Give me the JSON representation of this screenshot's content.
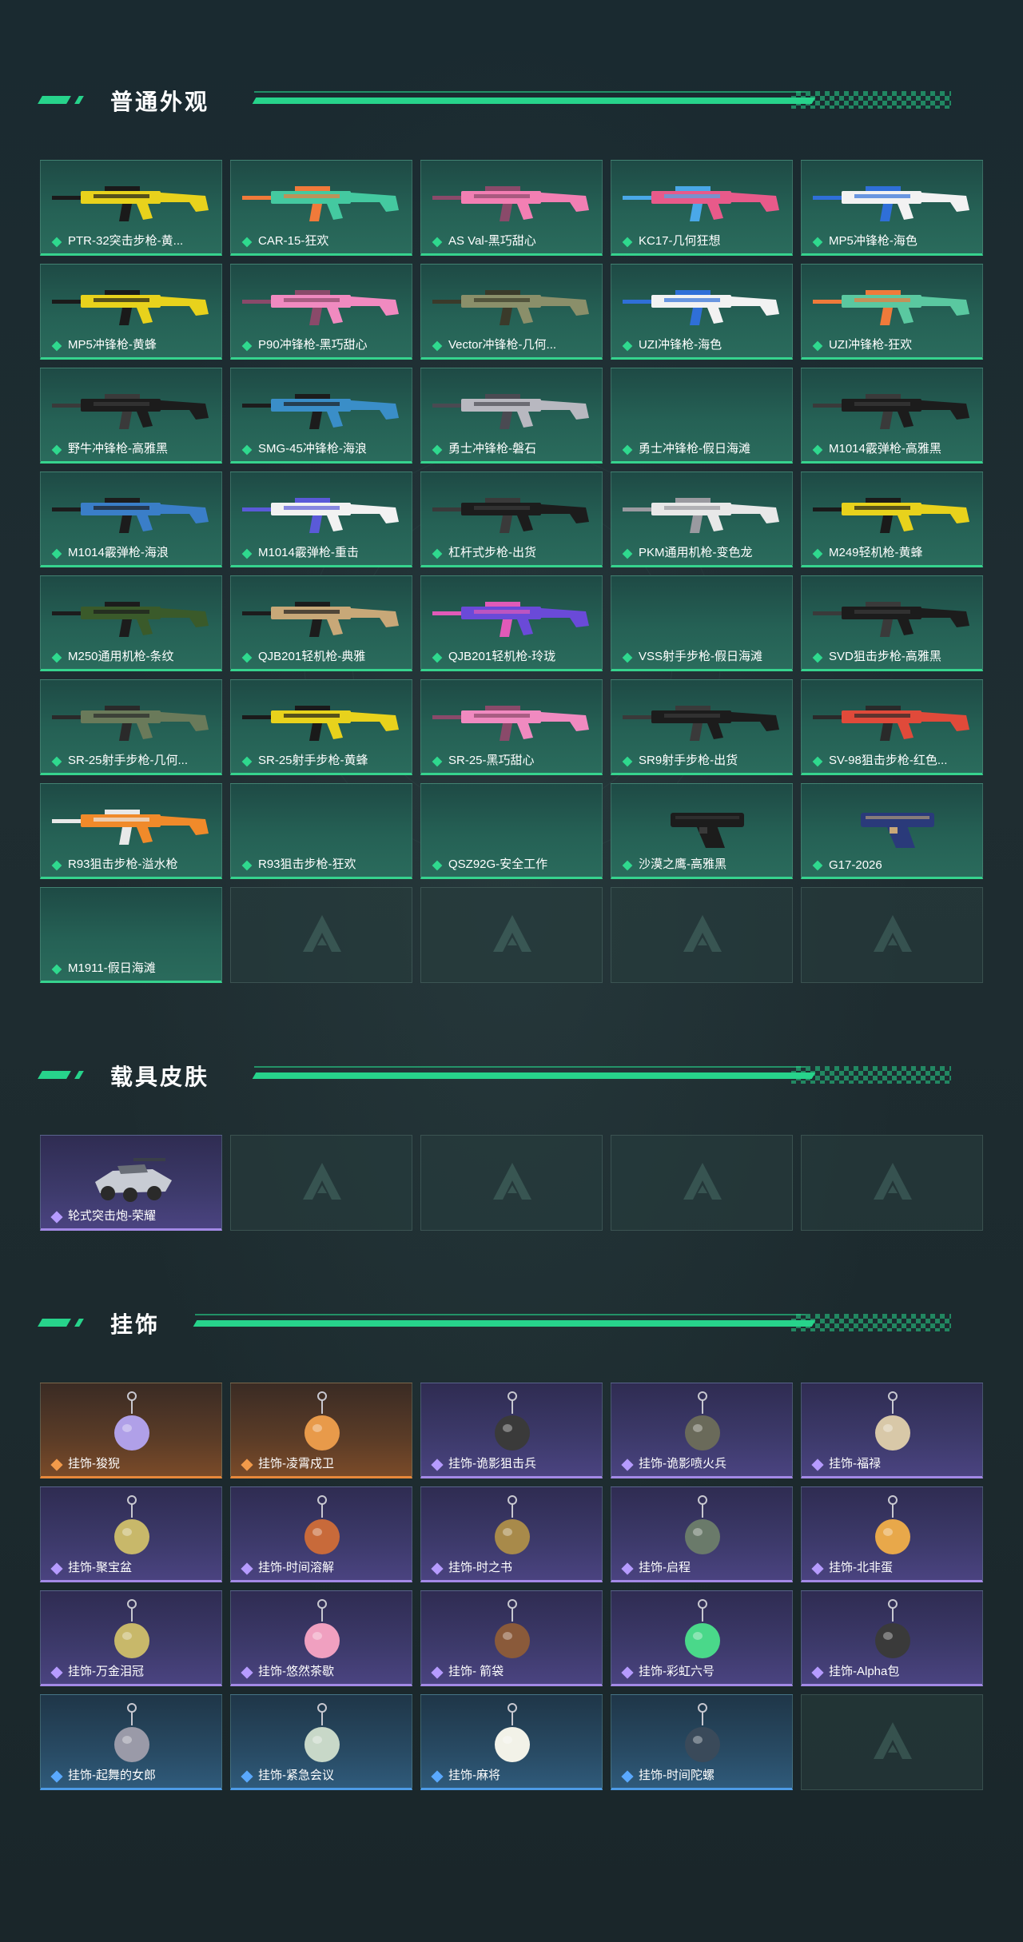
{
  "sections": {
    "weapons": {
      "title": "普通外观",
      "items": [
        {
          "label": "PTR-32突击步枪-黄...",
          "rarity": "green",
          "color": "#e8d21c",
          "accent": "#1a1a1a"
        },
        {
          "label": "CAR-15-狂欢",
          "rarity": "green",
          "color": "#44c9a0",
          "accent": "#f07a3a"
        },
        {
          "label": "AS Val-黑巧甜心",
          "rarity": "green",
          "color": "#f27fb3",
          "accent": "#8a4a6a"
        },
        {
          "label": "KC17-几何狂想",
          "rarity": "green",
          "color": "#e85a8a",
          "accent": "#4aa8e8"
        },
        {
          "label": "MP5冲锋枪-海色",
          "rarity": "green",
          "color": "#f2f2f2",
          "accent": "#2f6fd8"
        },
        {
          "label": "MP5冲锋枪-黄蜂",
          "rarity": "green",
          "color": "#e8d21c",
          "accent": "#1a1a1a"
        },
        {
          "label": "P90冲锋枪-黑巧甜心",
          "rarity": "green",
          "color": "#f08ac0",
          "accent": "#8a4a6a"
        },
        {
          "label": "Vector冲锋枪-几何...",
          "rarity": "green",
          "color": "#8a8f6a",
          "accent": "#3a3a2a"
        },
        {
          "label": "UZI冲锋枪-海色",
          "rarity": "green",
          "color": "#f2f2f2",
          "accent": "#2f6fd8"
        },
        {
          "label": "UZI冲锋枪-狂欢",
          "rarity": "green",
          "color": "#5ac8a0",
          "accent": "#f07a3a"
        },
        {
          "label": "野牛冲锋枪-高雅黑",
          "rarity": "green",
          "color": "#1c1c1c",
          "accent": "#3a3a3a"
        },
        {
          "label": "SMG-45冲锋枪-海浪",
          "rarity": "green",
          "color": "#3a8ec8",
          "accent": "#1c1c1c"
        },
        {
          "label": "勇士冲锋枪-磐石",
          "rarity": "green",
          "color": "#b8b8c0",
          "accent": "#4a4a52"
        },
        {
          "label": "勇士冲锋枪-假日海滩",
          "rarity": "green",
          "color": "",
          "accent": ""
        },
        {
          "label": "M1014霰弹枪-高雅黑",
          "rarity": "green",
          "color": "#1c1c1c",
          "accent": "#3a3a3a"
        },
        {
          "label": "M1014霰弹枪-海浪",
          "rarity": "green",
          "color": "#3a7ec8",
          "accent": "#1c1c1c"
        },
        {
          "label": "M1014霰弹枪-重击",
          "rarity": "green",
          "color": "#f2f2f2",
          "accent": "#5a5ad8"
        },
        {
          "label": "杠杆式步枪-出货",
          "rarity": "green",
          "color": "#1c1c1c",
          "accent": "#3a3a3a"
        },
        {
          "label": "PKM通用机枪-变色龙",
          "rarity": "green",
          "color": "#e8e8e8",
          "accent": "#9a9aa0"
        },
        {
          "label": "M249轻机枪-黄蜂",
          "rarity": "green",
          "color": "#e8d21c",
          "accent": "#1a1a1a"
        },
        {
          "label": "M250通用机枪-条纹",
          "rarity": "green",
          "color": "#3a5a2a",
          "accent": "#1c1c1c"
        },
        {
          "label": "QJB201轻机枪-典雅",
          "rarity": "green",
          "color": "#c8a878",
          "accent": "#1c1c1c"
        },
        {
          "label": "QJB201轻机枪-玲珑",
          "rarity": "green",
          "color": "#6a4ad8",
          "accent": "#e05ab8"
        },
        {
          "label": "VSS射手步枪-假日海滩",
          "rarity": "green",
          "color": "",
          "accent": ""
        },
        {
          "label": "SVD狙击步枪-高雅黑",
          "rarity": "green",
          "color": "#1c1c1c",
          "accent": "#3a3a3a"
        },
        {
          "label": "SR-25射手步枪-几何...",
          "rarity": "green",
          "color": "#6a7a5a",
          "accent": "#2a2a2a"
        },
        {
          "label": "SR-25射手步枪-黄蜂",
          "rarity": "green",
          "color": "#e8d21c",
          "accent": "#1a1a1a"
        },
        {
          "label": "SR-25-黑巧甜心",
          "rarity": "green",
          "color": "#f08ac0",
          "accent": "#8a4a6a"
        },
        {
          "label": "SR9射手步枪-出货",
          "rarity": "green",
          "color": "#1c1c1c",
          "accent": "#3a3a3a"
        },
        {
          "label": "SV-98狙击步枪-红色...",
          "rarity": "green",
          "color": "#e04a3a",
          "accent": "#2a2a2a"
        },
        {
          "label": "R93狙击步枪-溢水枪",
          "rarity": "green",
          "color": "#f08a2a",
          "accent": "#e8e8e8"
        },
        {
          "label": "R93狙击步枪-狂欢",
          "rarity": "green",
          "color": "",
          "accent": ""
        },
        {
          "label": "QSZ92G-安全工作",
          "rarity": "green",
          "color": "",
          "accent": ""
        },
        {
          "label": "沙漠之鹰-高雅黑",
          "rarity": "green",
          "color": "#1c1c1c",
          "accent": "#3a3a3a",
          "pistol": true
        },
        {
          "label": "G17-2026",
          "rarity": "green",
          "color": "#2a3a7a",
          "accent": "#c8a878",
          "pistol": true
        },
        {
          "label": "M1911-假日海滩",
          "rarity": "green",
          "color": "",
          "accent": ""
        },
        {
          "label": "",
          "rarity": "empty"
        },
        {
          "label": "",
          "rarity": "empty"
        },
        {
          "label": "",
          "rarity": "empty"
        },
        {
          "label": "",
          "rarity": "empty"
        }
      ]
    },
    "vehicles": {
      "title": "载具皮肤",
      "items": [
        {
          "label": "轮式突击炮-荣耀",
          "rarity": "purple"
        },
        {
          "label": "",
          "rarity": "empty"
        },
        {
          "label": "",
          "rarity": "empty"
        },
        {
          "label": "",
          "rarity": "empty"
        },
        {
          "label": "",
          "rarity": "empty"
        }
      ]
    },
    "charms": {
      "title": "挂饰",
      "items": [
        {
          "label": "挂饰-狻猊",
          "rarity": "orange",
          "color": "#b0a0e8"
        },
        {
          "label": "挂饰-凌霄戍卫",
          "rarity": "orange",
          "color": "#e89a4a"
        },
        {
          "label": "挂饰-诡影狙击兵",
          "rarity": "purple",
          "color": "#3a3a3a"
        },
        {
          "label": "挂饰-诡影喷火兵",
          "rarity": "purple",
          "color": "#6a6a5a"
        },
        {
          "label": "挂饰-福禄",
          "rarity": "purple",
          "color": "#d8c8a8"
        },
        {
          "label": "挂饰-聚宝盆",
          "rarity": "purple",
          "color": "#c8b86a"
        },
        {
          "label": "挂饰-时间溶解",
          "rarity": "purple",
          "color": "#c86a3a"
        },
        {
          "label": "挂饰-时之书",
          "rarity": "purple",
          "color": "#a88a4a"
        },
        {
          "label": "挂饰-启程",
          "rarity": "purple",
          "color": "#6a7a6a"
        },
        {
          "label": "挂饰-北非蛋",
          "rarity": "purple",
          "color": "#e8a84a"
        },
        {
          "label": "挂饰-万金泪冠",
          "rarity": "purple",
          "color": "#c8b86a"
        },
        {
          "label": "挂饰-悠然茶歇",
          "rarity": "purple",
          "color": "#f0a0c0"
        },
        {
          "label": "挂饰- 箭袋",
          "rarity": "purple",
          "color": "#8a5a3a"
        },
        {
          "label": "挂饰-彩虹六号",
          "rarity": "purple",
          "color": "#4ad88a"
        },
        {
          "label": "挂饰-Alpha包",
          "rarity": "purple",
          "color": "#3a3a3a"
        },
        {
          "label": "挂饰-起舞的女郎",
          "rarity": "blue",
          "color": "#9a9aa8"
        },
        {
          "label": "挂饰-紧急会议",
          "rarity": "blue",
          "color": "#c8d8c8"
        },
        {
          "label": "挂饰-麻将",
          "rarity": "blue",
          "color": "#f2f2e8"
        },
        {
          "label": "挂饰-时间陀螺",
          "rarity": "blue",
          "color": "#3a4a5a"
        },
        {
          "label": "",
          "rarity": "empty"
        }
      ]
    }
  }
}
